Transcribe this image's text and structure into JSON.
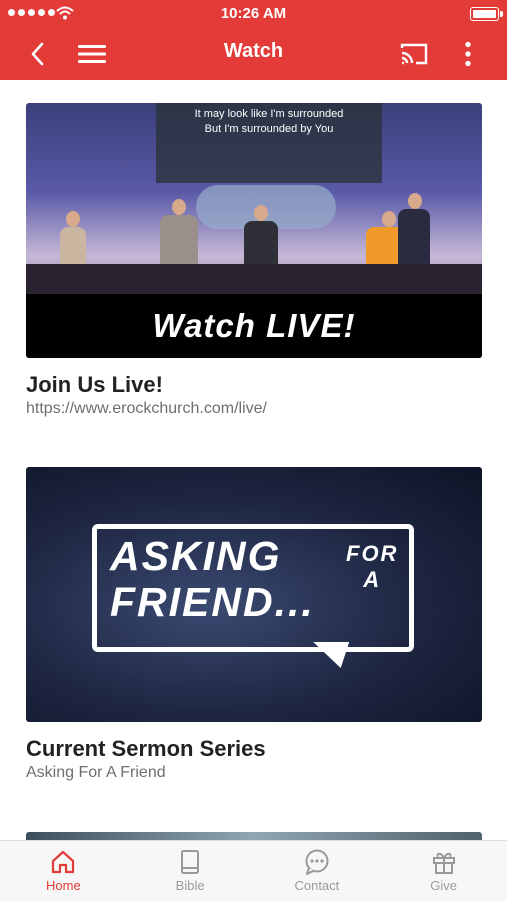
{
  "status_bar": {
    "time": "10:26 AM"
  },
  "header": {
    "title": "Watch"
  },
  "cards": [
    {
      "overlay_lyrics_line1": "It may look like I'm surrounded",
      "overlay_lyrics_line2": "But I'm surrounded by You",
      "overlay_banner": "Watch LIVE!",
      "title": "Join Us Live!",
      "subtitle": "https://www.erockchurch.com/live/"
    },
    {
      "overlay_line1": "ASKING",
      "overlay_line2": "FRIEND",
      "overlay_small1": "FOR",
      "overlay_small2": "A",
      "overlay_dots": "...",
      "title": "Current Sermon Series",
      "subtitle": "Asking For A Friend"
    }
  ],
  "tabs": [
    {
      "label": "Home",
      "icon": "home-icon",
      "active": true
    },
    {
      "label": "Bible",
      "icon": "book-icon",
      "active": false
    },
    {
      "label": "Contact",
      "icon": "chat-bubble-icon",
      "active": false
    },
    {
      "label": "Give",
      "icon": "gift-icon",
      "active": false
    }
  ],
  "colors": {
    "accent": "#e23b38",
    "tab_inactive": "#9a9a9a"
  }
}
